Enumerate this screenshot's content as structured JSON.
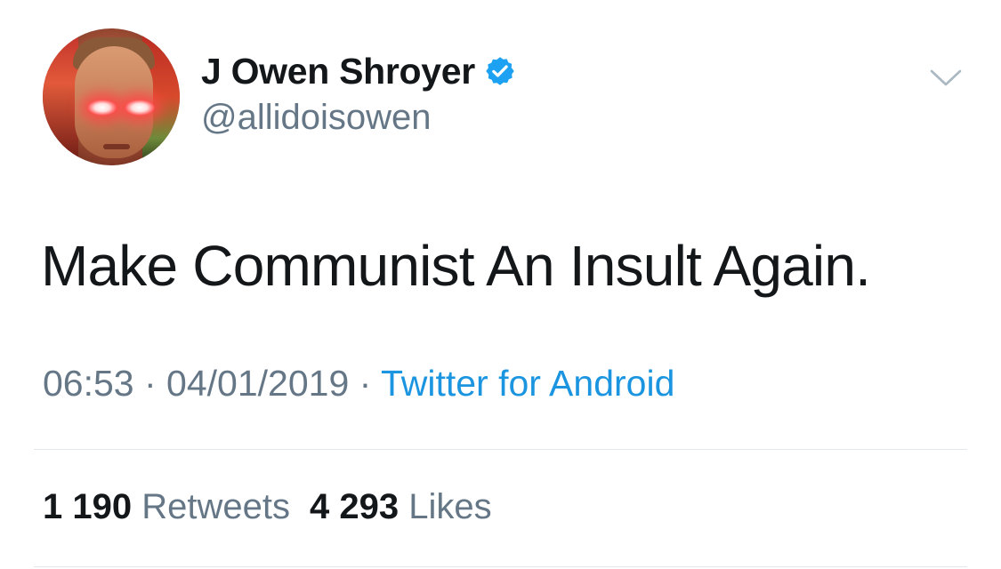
{
  "tweet": {
    "author": {
      "display_name": "J Owen Shroyer",
      "handle": "@allidoisowen",
      "verified": true,
      "avatar_icon": "profile-photo"
    },
    "text": "Make Communist An Insult Again.",
    "meta": {
      "time": "06:53",
      "separator": " · ",
      "date": "04/01/2019",
      "source": "Twitter for Android"
    },
    "stats": {
      "retweets_count": "1 190",
      "retweets_label": "Retweets",
      "likes_count": "4 293",
      "likes_label": "Likes"
    },
    "menu_icon": "chevron-down-icon"
  },
  "colors": {
    "text_primary": "#14171a",
    "text_secondary": "#657786",
    "link": "#1b95e0",
    "verified_badge": "#1da1f2",
    "divider": "#e1e8ed"
  }
}
